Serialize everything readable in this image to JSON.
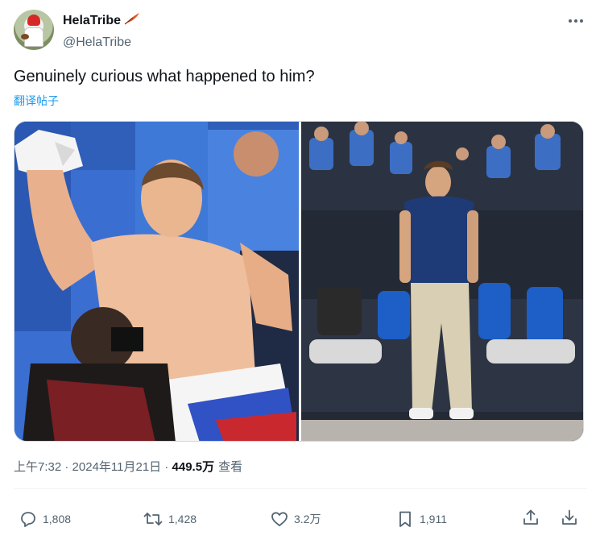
{
  "post": {
    "display_name": "HelaTribe",
    "handle": "@HelaTribe",
    "text": "Genuinely curious what happened to him?",
    "translate_label": "翻译帖子",
    "time": "上午7:32",
    "separator": " · ",
    "date": "2024年11月21日",
    "views_count": "449.5万",
    "views_label": "查看"
  },
  "icons": {
    "name_badge": "feather-icon",
    "more": "more-dots-icon",
    "reply": "reply-bubble-icon",
    "retweet": "retweet-icon",
    "like": "heart-icon",
    "bookmark": "bookmark-icon",
    "share": "share-upload-icon",
    "download": "download-icon"
  },
  "actions": {
    "replies": "1,808",
    "retweets": "1,428",
    "likes": "3.2万",
    "bookmarks": "1,911"
  },
  "colors": {
    "text_primary": "#0f1419",
    "text_secondary": "#536471",
    "link": "#1d9bf0",
    "border": "#cfd9de"
  }
}
